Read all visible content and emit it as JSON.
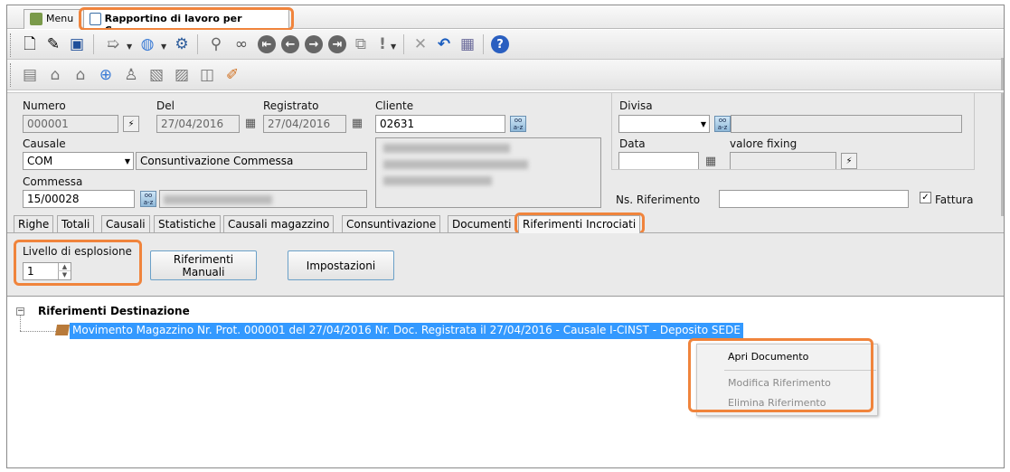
{
  "tabs": {
    "menu": "Menu",
    "active": "Rapportino di lavoro per Commessa"
  },
  "form": {
    "numero_label": "Numero",
    "numero": "000001",
    "del_label": "Del",
    "del": "27/04/2016",
    "registrato_label": "Registrato",
    "registrato": "27/04/2016",
    "cliente_label": "Cliente",
    "cliente": "02631",
    "divisa_label": "Divisa",
    "causale_label": "Causale",
    "causale_code": "COM",
    "causale_desc": "Consuntivazione Commessa",
    "data_label": "Data",
    "fixing_label": "valore fixing",
    "commessa_label": "Commessa",
    "commessa": "15/00028",
    "ns_rif_label": "Ns. Riferimento",
    "fattura_label": "Fattura",
    "fattura_checked": true
  },
  "subtabs": [
    "Righe",
    "Totali",
    "Causali",
    "Statistiche",
    "Causali magazzino",
    "Consuntivazione",
    "Documenti",
    "Riferimenti Incrociati"
  ],
  "options": {
    "livello_label": "Livello di esplosione",
    "livello": "1",
    "rif_manuali_line1": "Riferimenti",
    "rif_manuali_line2": "Manuali",
    "impostazioni": "Impostazioni"
  },
  "tree": {
    "root": "Riferimenti Destinazione",
    "child": "Movimento Magazzino Nr. Prot. 000001 del 27/04/2016 Nr. Doc.  Registrata il 27/04/2016  - Causale I-CINST - Deposito SEDE"
  },
  "context_menu": [
    "Apri Documento",
    "Modifica Riferimento",
    "Elimina Riferimento"
  ],
  "icons": [
    "new-doc-icon",
    "edit-doc-icon",
    "save-icon",
    "send-icon",
    "globe-icon",
    "settings-icon",
    "search-icon",
    "binoculars-icon",
    "first-icon",
    "prev-icon",
    "next-icon",
    "last-icon",
    "copy-icon",
    "exclamation-icon",
    "delete-icon",
    "undo-icon",
    "print-icon",
    "help-icon"
  ],
  "colors": {
    "highlight": "#f0843c",
    "selection": "#3399ff"
  }
}
